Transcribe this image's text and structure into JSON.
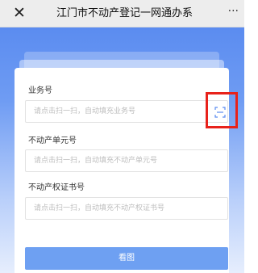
{
  "window": {
    "title": "江门市不动产登记一网通办系",
    "close_icon": "close-icon",
    "more_icon": "more-icon",
    "more_text": "···"
  },
  "form": {
    "business_no": {
      "label": "业务号",
      "placeholder": "请点击扫一扫，自动填充业务号",
      "scan_icon": "scan-icon"
    },
    "unit_no": {
      "label": "不动产单元号",
      "placeholder": "请点击扫一扫，自动填充不动产单元号"
    },
    "cert_no": {
      "label": "不动产权证书号",
      "placeholder": "请点击扫一扫，自动填充不动产权证书号"
    },
    "submit_label": "看图"
  },
  "colors": {
    "accent": "#6ea0f2",
    "highlight": "#e8221b",
    "header_bg": "#ededed"
  }
}
